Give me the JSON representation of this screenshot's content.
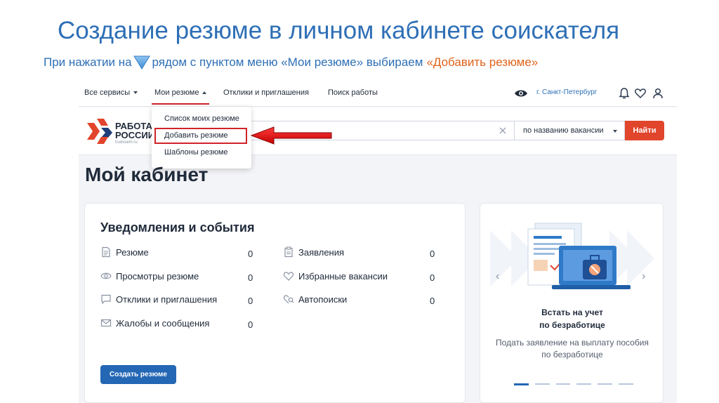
{
  "slide": {
    "title": "Создание резюме в личном кабинете соискателя",
    "subtitle_before": "При нажатии на",
    "subtitle_after": "рядом с пунктом меню «Мои резюме» выбираем",
    "subtitle_highlight": "«Добавить резюме»"
  },
  "topnav": {
    "all_services": "Все сервисы",
    "my_resumes": "Мои резюме",
    "responses": "Отклики и приглашения",
    "job_search": "Поиск работы",
    "city": "г. Санкт-Петербург"
  },
  "header": {
    "logo_line1": "РАБОТА",
    "logo_line2": "РОССИИ",
    "logo_url": "trudvsem.ru",
    "search_mode": "по названию вакансии",
    "search_button": "Найти"
  },
  "dropdown": {
    "items": [
      "Список моих резюме",
      "Добавить резюме",
      "Шаблоны резюме"
    ]
  },
  "cabinet": {
    "title": "Мой кабинет",
    "notifications": {
      "title": "Уведомления и события",
      "left": [
        {
          "label": "Резюме",
          "value": "0"
        },
        {
          "label": "Просмотры резюме",
          "value": "0"
        },
        {
          "label": "Отклики и приглашения",
          "value": "0"
        },
        {
          "label": "Жалобы и сообщения",
          "value": "0"
        }
      ],
      "right": [
        {
          "label": "Заявления",
          "value": "0"
        },
        {
          "label": "Избранные вакансии",
          "value": "0"
        },
        {
          "label": "Автопоиски",
          "value": "0"
        }
      ],
      "create_button": "Создать резюме"
    },
    "side": {
      "title_line1": "Встать на учет",
      "title_line2": "по безработице",
      "desc_line1": "Подать заявление на выплату пособия",
      "desc_line2": "по безработице",
      "slides_total": 6,
      "active_slide": 1
    }
  },
  "colors": {
    "title_blue": "#2e6fb6",
    "highlight_orange": "#e0621a",
    "accent_red": "#d2222a",
    "button_blue": "#2467b5",
    "find_button": "#e1452b"
  }
}
